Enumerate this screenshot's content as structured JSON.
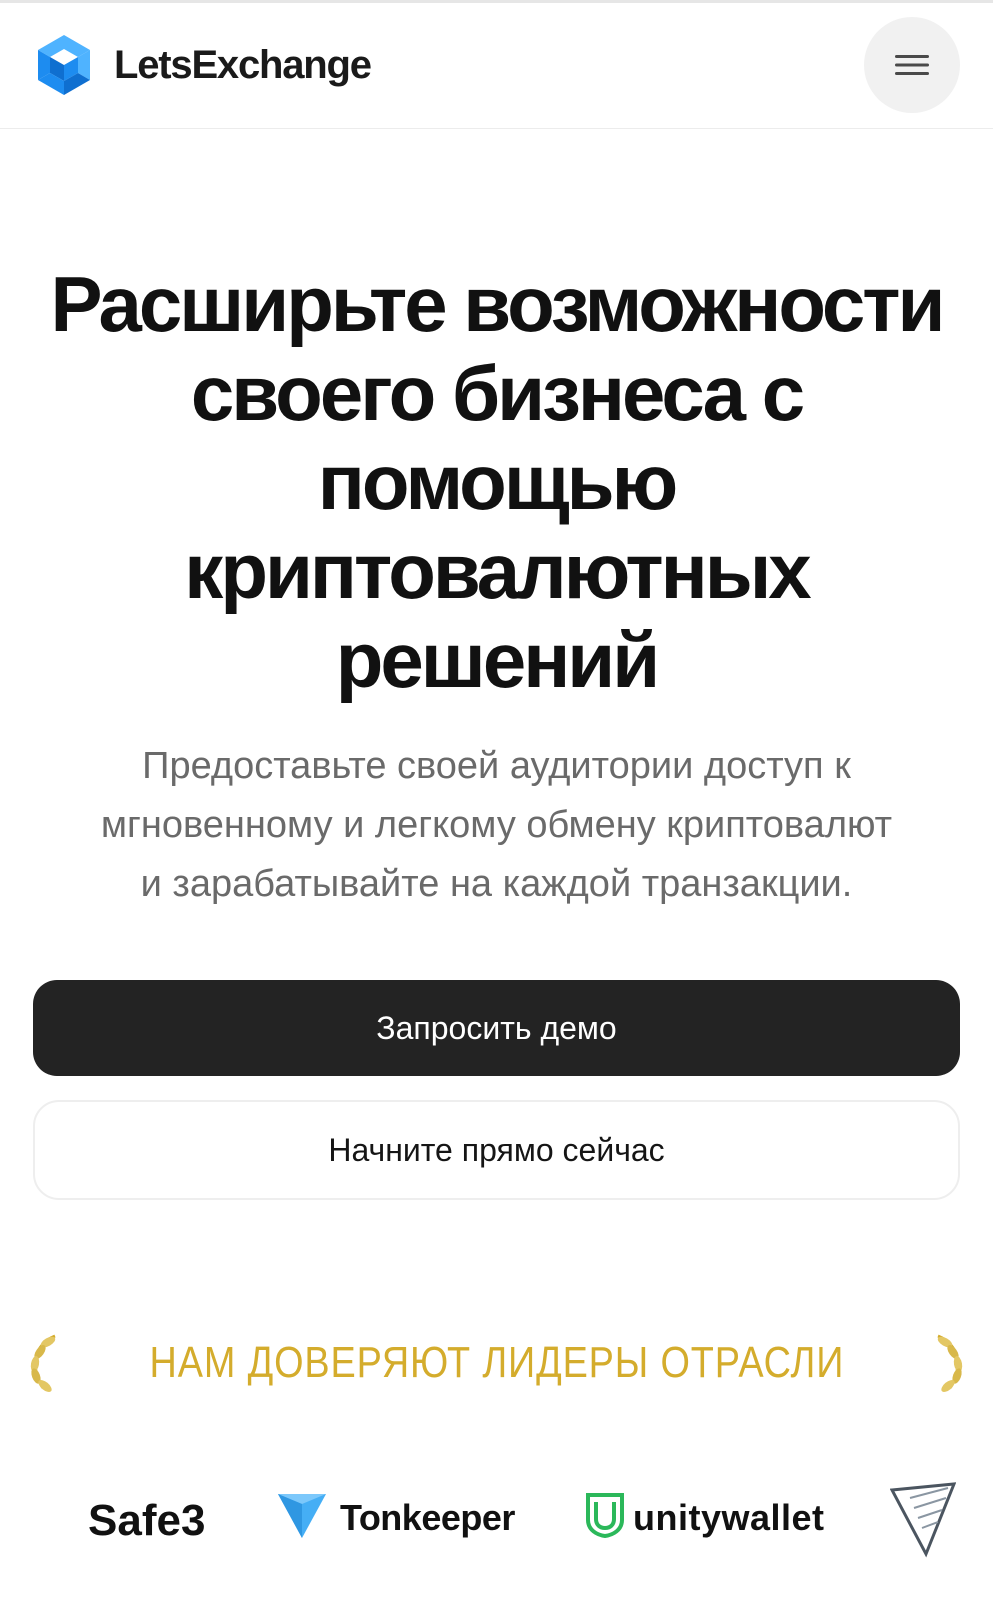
{
  "header": {
    "brand_name": "LetsExchange",
    "logo_icon": "letsexchange-cube-icon",
    "menu_icon": "hamburger-menu-icon"
  },
  "hero": {
    "title_lines": [
      "Расширьте возможности",
      "своего бизнеса с",
      "помощью",
      "криптовалютных",
      "решений"
    ],
    "subtitle_lines": [
      "Предоставьте своей аудитории доступ к",
      "мгновенному и легкому обмену криптовалют",
      "и зарабатывайте на каждой транзакции."
    ]
  },
  "actions": {
    "primary_label": "Запросить демо",
    "secondary_label": "Начните прямо сейчас"
  },
  "trust": {
    "label": "НАМ ДОВЕРЯЮТ ЛИДЕРЫ ОТРАСЛИ",
    "laurel_icon": "laurel-icon"
  },
  "partners": [
    {
      "name": "Safe3"
    },
    {
      "name": "Tonkeeper",
      "icon": "tonkeeper-diamond-icon"
    },
    {
      "name": "unitywallet",
      "icon": "unitywallet-shield-icon"
    },
    {
      "name": "",
      "icon": "partner-triangle-logo-icon"
    }
  ],
  "colors": {
    "brand_blue": "#1d8cf0",
    "brand_blue_light": "#4fb3ff",
    "primary_button_bg": "#232323",
    "trust_gold": "#d4ac2c",
    "subtitle_gray": "#6a6a6a",
    "unity_green": "#2bb85a",
    "tonkeeper_blue": "#45aef5"
  }
}
